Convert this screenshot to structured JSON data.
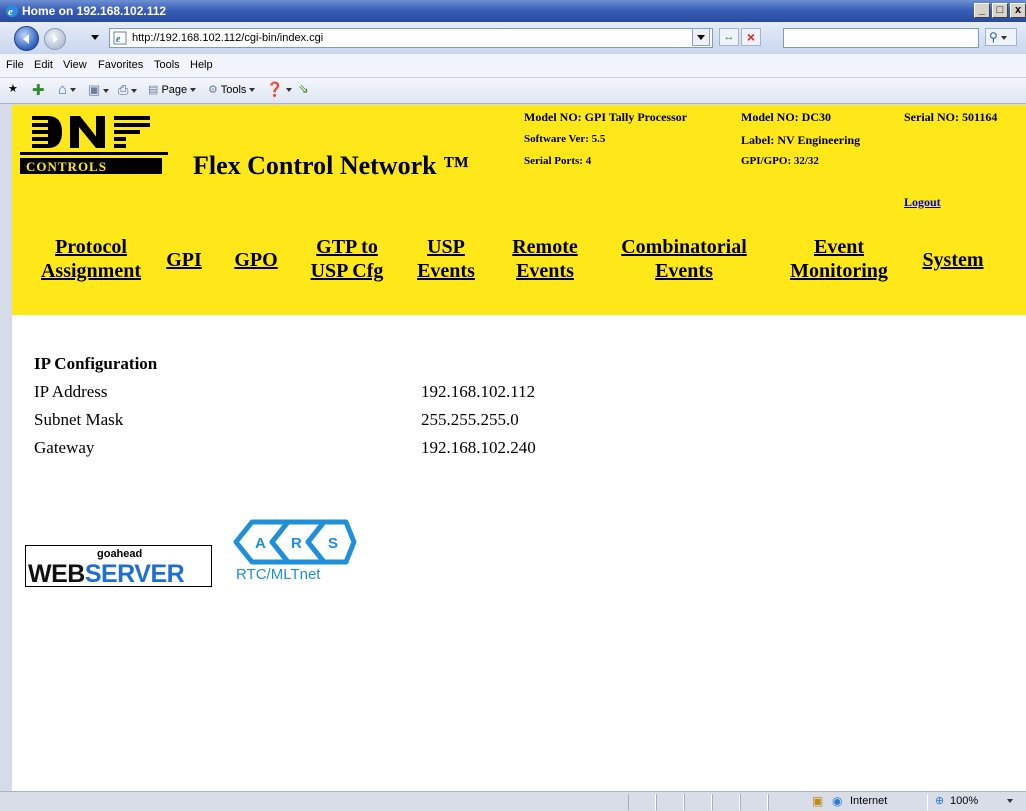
{
  "window": {
    "title": "Home on 192.168.102.112",
    "minimize": "_",
    "maximize": "□",
    "close": "x"
  },
  "address": {
    "url": "http://192.168.102.112/cgi-bin/index.cgi"
  },
  "menu": {
    "file": "File",
    "edit": "Edit",
    "view": "View",
    "favorites": "Favorites",
    "tools": "Tools",
    "help": "Help"
  },
  "command_bar": {
    "page": "Page",
    "tools": "Tools"
  },
  "header": {
    "logo_text": "DNF",
    "logo_sub": "CONTROLS",
    "title": "Flex Control Network ™",
    "info": {
      "model_no_1": "Model NO: GPI Tally Processor",
      "software_ver": "Software Ver: 5.5",
      "serial_ports": "Serial Ports: 4",
      "model_no_2": "Model NO: DC30",
      "label": "Label: NV Engineering",
      "gpi_gpo": "GPI/GPO: 32/32",
      "serial_no": "Serial NO: 501164"
    },
    "logout": "Logout"
  },
  "nav": {
    "protocol_1": "Protocol",
    "protocol_2": "Assignment",
    "gpi": "GPI",
    "gpo": "GPO",
    "gtp_1": "GTP to",
    "gtp_2": "USP Cfg",
    "usp_1": "USP",
    "usp_2": "Events",
    "remote_1": "Remote",
    "remote_2": "Events",
    "comb_1": "Combinatorial",
    "comb_2": "Events",
    "event_1": "Event",
    "event_2": "Monitoring",
    "system": "System"
  },
  "ip_config": {
    "title": "IP Configuration",
    "rows": [
      {
        "label": "IP Address",
        "value": "192.168.102.112"
      },
      {
        "label": "Subnet Mask",
        "value": "255.255.255.0"
      },
      {
        "label": "Gateway",
        "value": "192.168.102.240"
      }
    ]
  },
  "footer_logos": {
    "goahead": "goahead",
    "web": "WEB",
    "server": "SERVER",
    "ars_a": "A",
    "ars_r": "R",
    "ars_s": "S",
    "rtc": "RTC/MLTnet"
  },
  "status": {
    "zone": "Internet",
    "zoom": "100%"
  },
  "colors": {
    "banner": "#ffe81a",
    "link": "#0000cc"
  }
}
